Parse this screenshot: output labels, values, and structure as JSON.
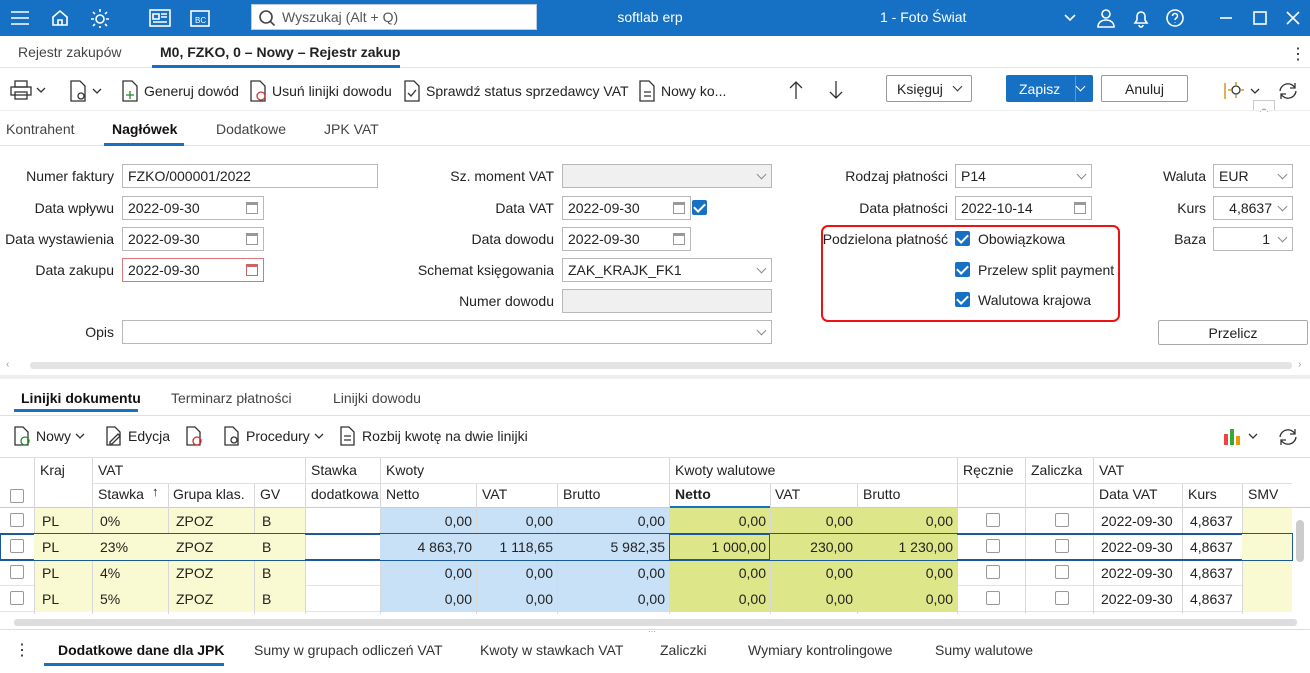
{
  "titlebar": {
    "search_placeholder": "Wyszukaj (Alt + Q)",
    "app_title": "softlab erp",
    "company": "1 - Foto Świat",
    "accent": "#1670c4"
  },
  "doc_tabs": [
    {
      "label": "Rejestr zakupów"
    },
    {
      "label": "M0, FZKO, 0 – Nowy – Rejestr zakupów"
    }
  ],
  "toolbar": {
    "generate": "Generuj dowód",
    "delete_lines": "Usuń linijki dowodu",
    "check_vat": "Sprawdź status sprzedawcy VAT",
    "new_ko": "Nowy ko...",
    "post": "Księguj",
    "save": "Zapisz",
    "cancel": "Anuluj"
  },
  "section_tabs": [
    "Kontrahent",
    "Nagłówek",
    "Dodatkowe",
    "JPK VAT"
  ],
  "form": {
    "invoice_no_label": "Numer faktury",
    "invoice_no": "FZKO/000001/2022",
    "receipt_date_label": "Data wpływu",
    "receipt_date": "2022-09-30",
    "issue_date_label": "Data wystawienia",
    "issue_date": "2022-09-30",
    "purchase_date_label": "Data zakupu",
    "purchase_date": "2022-09-30",
    "desc_label": "Opis",
    "vat_moment_label": "Sz. moment VAT",
    "vat_date_label": "Data VAT",
    "vat_date": "2022-09-30",
    "proof_date_label": "Data dowodu",
    "proof_date": "2022-09-30",
    "scheme_label": "Schemat księgowania",
    "scheme": "ZAK_KRAJK_FK1",
    "proof_no_label": "Numer dowodu",
    "pay_type_label": "Rodzaj płatności",
    "pay_type": "P14",
    "pay_date_label": "Data płatności",
    "pay_date": "2022-10-14",
    "split_label": "Podzielona płatność",
    "split_opt1": "Obowiązkowa",
    "split_opt2": "Przelew split payment",
    "split_opt3": "Walutowa krajowa",
    "currency_label": "Waluta",
    "currency": "EUR",
    "rate_label": "Kurs",
    "rate": "4,8637",
    "base_label": "Baza",
    "base": "1",
    "recalc": "Przelicz"
  },
  "line_tabs": [
    "Linijki dokumentu",
    "Terminarz płatności",
    "Linijki dowodu"
  ],
  "grid_toolbar": {
    "new": "Nowy",
    "edit": "Edycja",
    "procedures": "Procedury",
    "split": "Rozbij kwotę na dwie linijki"
  },
  "grid": {
    "groups": {
      "country": "Kraj",
      "vat": "VAT",
      "extra_rate1": "Stawka",
      "extra_rate2": "dodatkowa",
      "amounts": "Kwoty",
      "fx_amounts": "Kwoty walutowe",
      "manual": "Ręcznie",
      "advance": "Zaliczka",
      "vat2": "VAT"
    },
    "cols": {
      "rate": "Stawka",
      "group": "Grupa klas.",
      "gv": "GV",
      "netto": "Netto",
      "vat": "VAT",
      "brutto": "Brutto",
      "fnetto": "Netto",
      "fvat": "VAT",
      "fbrutto": "Brutto",
      "vat_date": "Data VAT",
      "kurs": "Kurs",
      "smv": "SMV"
    },
    "rows": [
      {
        "country": "PL",
        "rate": "0%",
        "group": "ZPOZ",
        "gv": "B",
        "netto": "0,00",
        "vat": "0,00",
        "brutto": "0,00",
        "fnetto": "0,00",
        "fvat": "0,00",
        "fbrutto": "0,00",
        "vat_date": "2022-09-30",
        "kurs": "4,8637"
      },
      {
        "country": "PL",
        "rate": "23%",
        "group": "ZPOZ",
        "gv": "B",
        "netto": "4 863,70",
        "vat": "1 118,65",
        "brutto": "5 982,35",
        "fnetto": "1 000,00",
        "fvat": "230,00",
        "fbrutto": "1 230,00",
        "vat_date": "2022-09-30",
        "kurs": "4,8637"
      },
      {
        "country": "PL",
        "rate": "4%",
        "group": "ZPOZ",
        "gv": "B",
        "netto": "0,00",
        "vat": "0,00",
        "brutto": "0,00",
        "fnetto": "0,00",
        "fvat": "0,00",
        "fbrutto": "0,00",
        "vat_date": "2022-09-30",
        "kurs": "4,8637"
      },
      {
        "country": "PL",
        "rate": "5%",
        "group": "ZPOZ",
        "gv": "B",
        "netto": "0,00",
        "vat": "0,00",
        "brutto": "0,00",
        "fnetto": "0,00",
        "fvat": "0,00",
        "fbrutto": "0,00",
        "vat_date": "2022-09-30",
        "kurs": "4,8637"
      }
    ]
  },
  "bottom_tabs": [
    "Dodatkowe dane dla JPK",
    "Sumy w grupach odliczeń VAT",
    "Kwoty w stawkach VAT",
    "Zaliczki",
    "Wymiary kontrolingowe",
    "Sumy walutowe"
  ]
}
